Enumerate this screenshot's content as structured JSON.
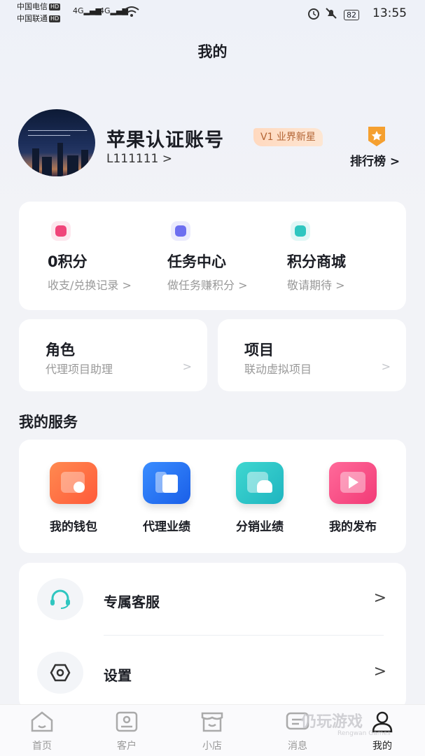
{
  "status_bar": {
    "carrier1": "中国电信",
    "carrier2": "中国联通",
    "hd": "HD",
    "signal1": "4G",
    "signal2": "4G",
    "battery": "82",
    "time": "13:55"
  },
  "header": {
    "title": "我的"
  },
  "profile": {
    "name": "苹果认证账号",
    "level": "V1 业界新星",
    "uid": "L111111 >",
    "ranking_label": "排行榜 >"
  },
  "points": [
    {
      "title": "0积分",
      "sub": "收支/兑换记录 >",
      "icon": "star-icon",
      "color": "#f0457a",
      "bg": "#fde7ee"
    },
    {
      "title": "任务中心",
      "sub": "做任务赚积分 >",
      "icon": "tv-icon",
      "color": "#6d6ff0",
      "bg": "#ebebfd"
    },
    {
      "title": "积分商城",
      "sub": "敬请期待 >",
      "icon": "bag-icon",
      "color": "#2fc6c0",
      "bg": "#e1f7f6"
    }
  ],
  "role_card": {
    "title": "角色",
    "sub": "代理项目助理",
    "chevron": ">"
  },
  "project_card": {
    "title": "项目",
    "sub": "联动虚拟项目",
    "chevron": ">"
  },
  "services": {
    "title": "我的服务",
    "items": [
      {
        "label": "我的钱包",
        "icon": "wallet-icon"
      },
      {
        "label": "代理业绩",
        "icon": "agent-performance-icon"
      },
      {
        "label": "分销业绩",
        "icon": "distribution-icon"
      },
      {
        "label": "我的发布",
        "icon": "publish-icon"
      }
    ]
  },
  "menu": [
    {
      "label": "专属客服",
      "icon": "headset-icon",
      "arrow": ">"
    },
    {
      "label": "设置",
      "icon": "settings-icon",
      "arrow": ">"
    }
  ],
  "tabbar": [
    {
      "label": "首页",
      "icon": "home-icon"
    },
    {
      "label": "客户",
      "icon": "customer-icon"
    },
    {
      "label": "小店",
      "icon": "shop-icon"
    },
    {
      "label": "消息",
      "icon": "message-icon"
    },
    {
      "label": "我的",
      "icon": "user-icon",
      "active": true
    }
  ],
  "watermark": {
    "text": "仍玩游戏",
    "sub": "Rengwan Games"
  },
  "colors": {
    "background": "#f2f3f7",
    "level_text": "#b36535",
    "rank_badge": "#f5a030"
  }
}
